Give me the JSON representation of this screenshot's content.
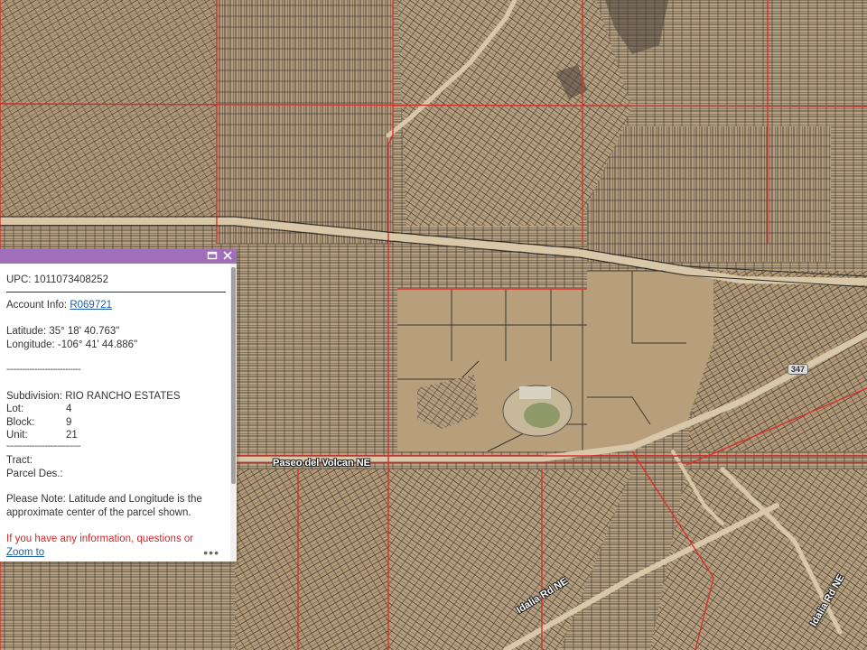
{
  "map": {
    "base_color": "#b49b7b",
    "parcel_line_color": "#3a342c",
    "boundary_line_color": "#d83030",
    "road_labels": {
      "paseo": "Paseo del Volcan NE",
      "unser": "Idalia Rd NE",
      "right": "Idalia Rd NE"
    },
    "route_shield": "347"
  },
  "popup": {
    "header_color": "#9f6fba",
    "maximize_icon": "maximize-icon",
    "close_icon": "close-icon",
    "upc": "UPC: 1011073408252",
    "account_label": "Account Info: ",
    "account_link": "R069721",
    "latitude": "Latitude: 35° 18' 40.763\"",
    "longitude": "Longitude: -106° 41' 44.886\"",
    "dashes1": "-----------------------------",
    "subdivision": "Subdivision: RIO RANCHO ESTATES",
    "lot_label": "Lot:",
    "lot_value": "4",
    "block_label": "Block:",
    "block_value": "9",
    "unit_label": "Unit:",
    "unit_value": "21",
    "dashes2": "-----------------------------",
    "tract_label": "Tract:",
    "parcel_des_label": "Parcel Des.:",
    "note_line1": "Please Note: Latitude and Longitude is the",
    "note_line2": "approximate center of the parcel shown.",
    "warning": "If you have any information, questions or",
    "zoom_to": "Zoom to",
    "more": "•••"
  }
}
